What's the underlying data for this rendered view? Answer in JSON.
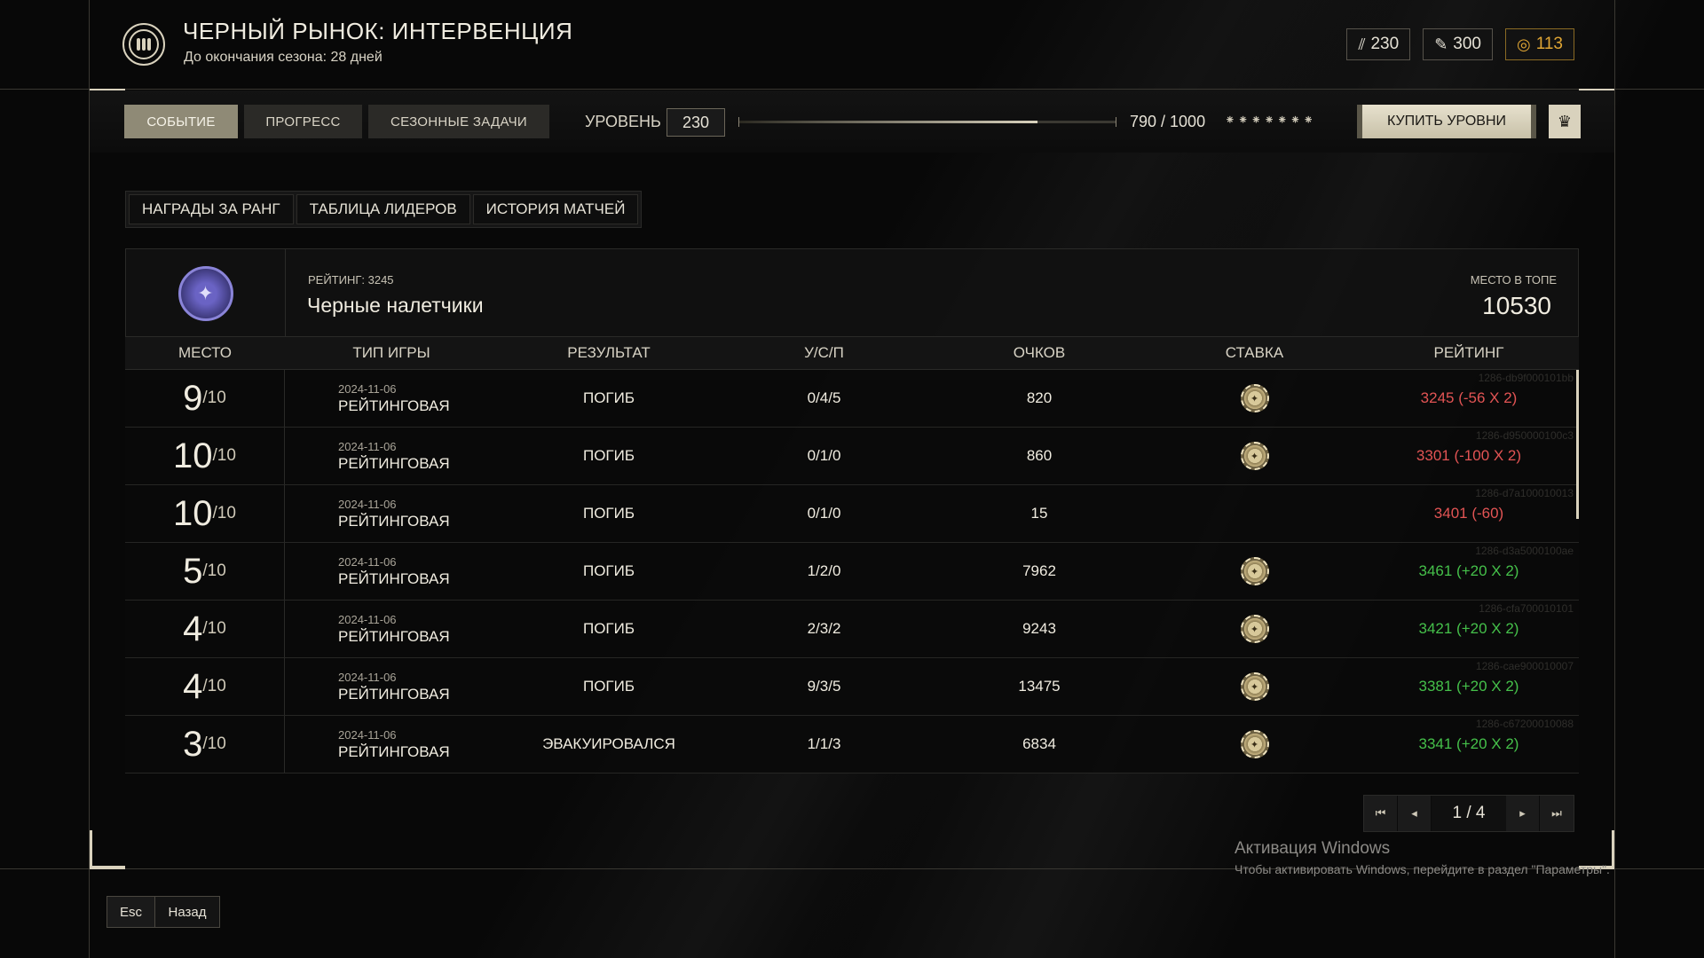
{
  "header": {
    "title": "ЧЕРНЫЙ РЫНОК: ИНТЕРВЕНЦИЯ",
    "subtitle": "До окончания сезона: 28 дней",
    "currencies": [
      {
        "icon": "ammo-icon",
        "value": "230"
      },
      {
        "icon": "ticket-icon",
        "value": "300"
      },
      {
        "icon": "coin-icon",
        "value": "113"
      }
    ]
  },
  "nav": {
    "tabs": [
      "СОБЫТИЕ",
      "ПРОГРЕСС",
      "СЕЗОННЫЕ ЗАДАЧИ"
    ],
    "active_tab": 0,
    "level_label": "УРОВЕНЬ",
    "level_value": "230",
    "xp_text": "790 / 1000",
    "xp_progress": 0.79,
    "stars": "⁕⁕⁕⁕⁕⁕⁕",
    "buy_label": "КУПИТЬ УРОВНИ",
    "crown_icon": "crown-icon"
  },
  "subtabs": [
    "НАГРАДЫ ЗА РАНГ",
    "ТАБЛИЦА ЛИДЕРОВ",
    "ИСТОРИЯ МАТЧЕЙ"
  ],
  "team": {
    "rating_label": "РЕЙТИНГ: 3245",
    "name": "Черные налетчики",
    "top_label": "МЕСТО В ТОПЕ",
    "top_value": "10530"
  },
  "table": {
    "headers": [
      "МЕСТО",
      "ТИП ИГРЫ",
      "РЕЗУЛЬТАТ",
      "У/С/П",
      "ОЧКОВ",
      "СТАВКА",
      "РЕЙТИНГ"
    ],
    "rows": [
      {
        "place": "9",
        "of": "/10",
        "date": "2024-11-06",
        "type": "РЕЙТИНГОВАЯ",
        "result": "ПОГИБ",
        "kda": "0/4/5",
        "score": "820",
        "bet": true,
        "rating": "3245 (-56 X 2)",
        "trend": "neg",
        "id": "1286-db9f000101bb"
      },
      {
        "place": "10",
        "of": "/10",
        "date": "2024-11-06",
        "type": "РЕЙТИНГОВАЯ",
        "result": "ПОГИБ",
        "kda": "0/1/0",
        "score": "860",
        "bet": true,
        "rating": "3301 (-100 X 2)",
        "trend": "neg",
        "id": "1286-d950000100c3"
      },
      {
        "place": "10",
        "of": "/10",
        "date": "2024-11-06",
        "type": "РЕЙТИНГОВАЯ",
        "result": "ПОГИБ",
        "kda": "0/1/0",
        "score": "15",
        "bet": false,
        "rating": "3401 (-60)",
        "trend": "neg",
        "id": "1286-d7a100010013"
      },
      {
        "place": "5",
        "of": "/10",
        "date": "2024-11-06",
        "type": "РЕЙТИНГОВАЯ",
        "result": "ПОГИБ",
        "kda": "1/2/0",
        "score": "7962",
        "bet": true,
        "rating": "3461 (+20 X 2)",
        "trend": "pos",
        "id": "1286-d3a5000100ae"
      },
      {
        "place": "4",
        "of": "/10",
        "date": "2024-11-06",
        "type": "РЕЙТИНГОВАЯ",
        "result": "ПОГИБ",
        "kda": "2/3/2",
        "score": "9243",
        "bet": true,
        "rating": "3421 (+20 X 2)",
        "trend": "pos",
        "id": "1286-cfa700010101"
      },
      {
        "place": "4",
        "of": "/10",
        "date": "2024-11-06",
        "type": "РЕЙТИНГОВАЯ",
        "result": "ПОГИБ",
        "kda": "9/3/5",
        "score": "13475",
        "bet": true,
        "rating": "3381 (+20 X 2)",
        "trend": "pos",
        "id": "1286-cae900010007"
      },
      {
        "place": "3",
        "of": "/10",
        "date": "2024-11-06",
        "type": "РЕЙТИНГОВАЯ",
        "result": "ЭВАКУИРОВАЛСЯ",
        "kda": "1/1/3",
        "score": "6834",
        "bet": true,
        "rating": "3341 (+20 X 2)",
        "trend": "pos",
        "id": "1286-c67200010088"
      }
    ]
  },
  "pager": {
    "text": "1 / 4"
  },
  "watermark": {
    "line1": "Активация Windows",
    "line2": "Чтобы активировать Windows, перейдите в раздел \"Параметры\"."
  },
  "footer": {
    "esc": "Esc",
    "back": "Назад"
  }
}
